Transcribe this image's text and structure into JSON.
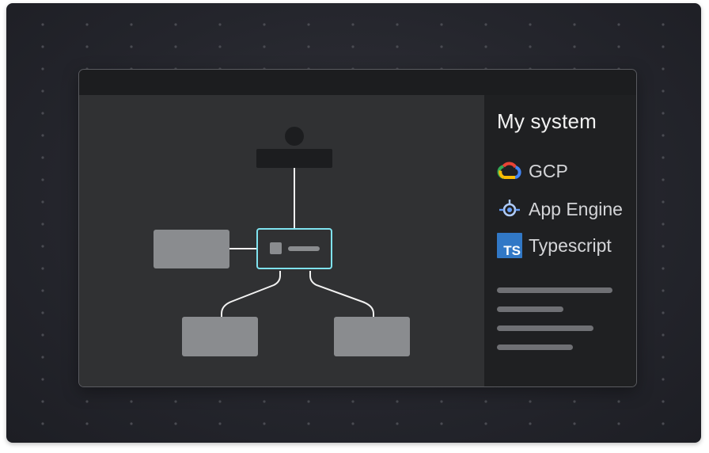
{
  "panel": {
    "title": "My system",
    "items": [
      {
        "label": "GCP",
        "icon": "google-cloud-icon"
      },
      {
        "label": "App Engine",
        "icon": "app-engine-icon"
      },
      {
        "label": "Typescript",
        "icon": "typescript-icon",
        "icon_text": "TS"
      }
    ],
    "placeholder_line_count": 4
  },
  "colors": {
    "background": "#25262c",
    "canvas": "#303133",
    "panel": "#1f2022",
    "node_fill": "#8a8c8f",
    "selected_node_border": "#7fe3f0",
    "typescript_blue": "#3178c6"
  }
}
